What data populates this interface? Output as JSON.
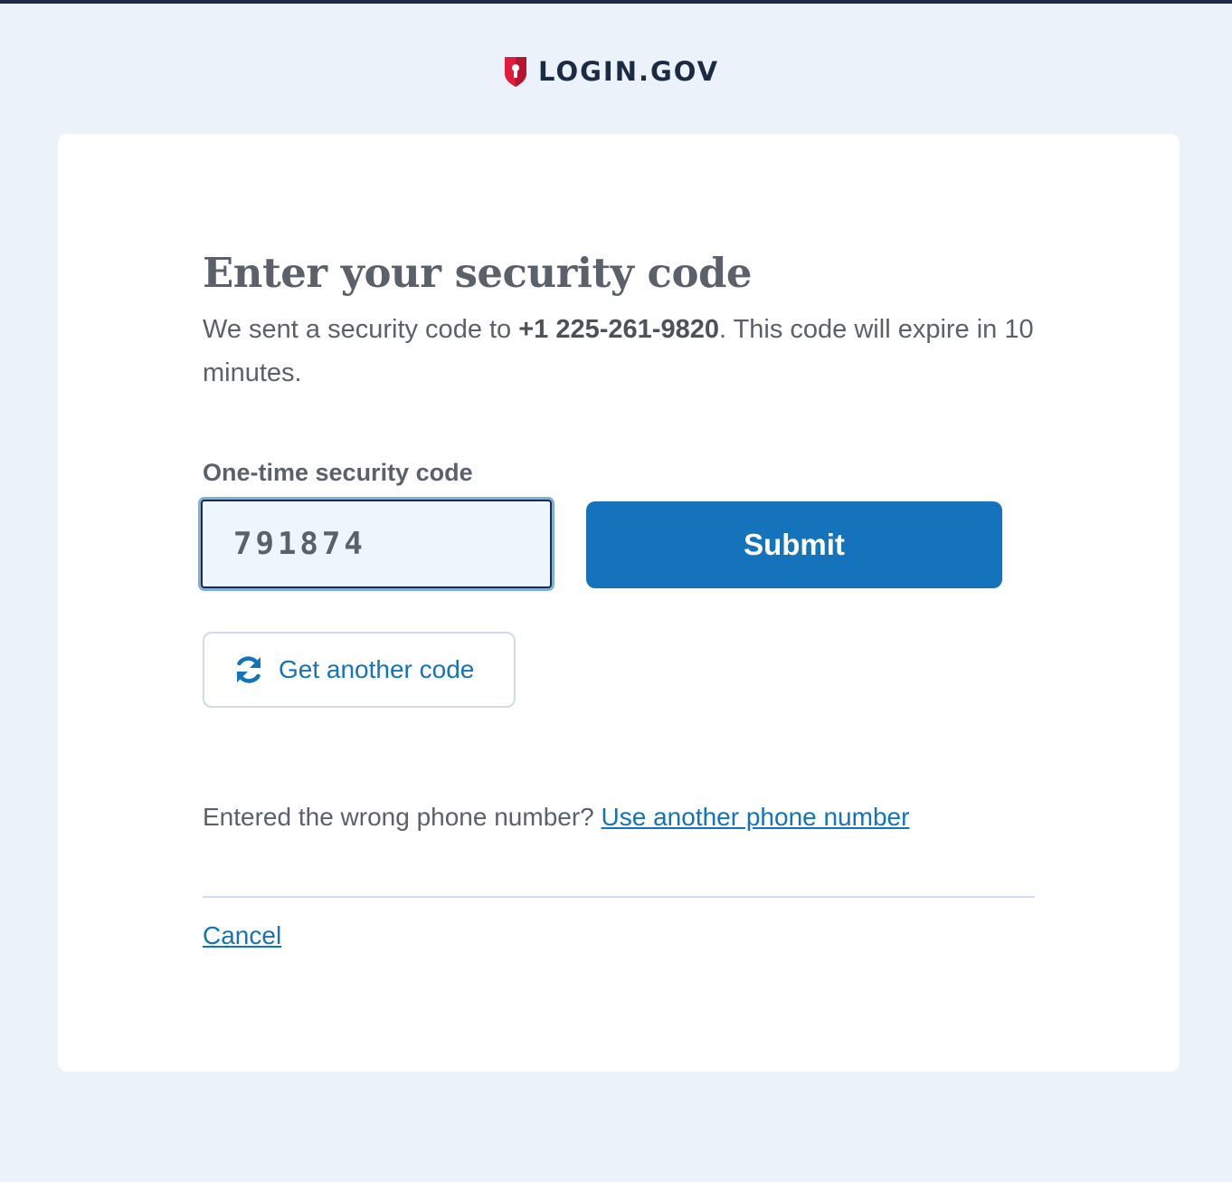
{
  "header": {
    "logo_text": "LOGIN.GOV",
    "logo_icon": "shield-keyhole-icon",
    "accent_color": "#e21c3d",
    "brand_color": "#1b2b45"
  },
  "main": {
    "title": "Enter your security code",
    "intro": {
      "prefix": "We sent a security code to ",
      "phone": "+1 225-261-9820",
      "suffix": ". This code will expire in 10 minutes."
    },
    "code_field": {
      "label": "One-time security code",
      "value": "791874"
    },
    "submit_label": "Submit",
    "resend": {
      "label": "Get another code",
      "icon": "refresh-icon"
    },
    "wrong_phone": {
      "text": "Entered the wrong phone number?",
      "link": "Use another phone number"
    },
    "cancel_label": "Cancel"
  },
  "colors": {
    "page_background": "#ebf2fa",
    "primary_button": "#1473bb",
    "link": "#1473bb",
    "text": "#5b616b"
  }
}
